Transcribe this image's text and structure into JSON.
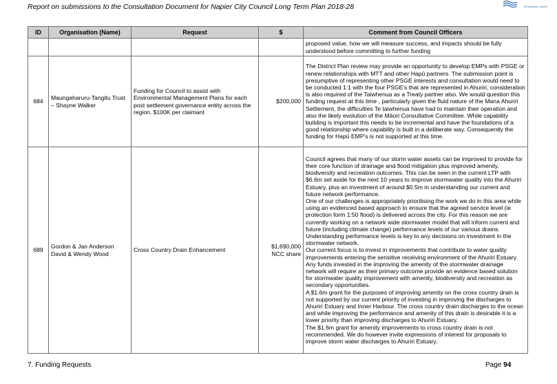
{
  "header": {
    "title": "Report on submissions to the Consultation Document for Napier City Council Long Term Plan 2018-28",
    "logo_caption": "Te Kaunihera o Ahuriri"
  },
  "table": {
    "columns": [
      "ID",
      "Organisation (Name)",
      "Request",
      "$",
      "Comment from Council Officers"
    ],
    "continuation": {
      "comment": "proposed value, how we will measure success, and impacts should be fully understood before committing to further funding"
    },
    "rows": [
      {
        "id": "684",
        "organisation": "Maungaharuru-Tangitu Trust – Shayne Walker",
        "request": "Funding for Council to assist with Environmental Management Plans for each post settlement governance entity across the region. $100K per claimant",
        "amount": "$200,000",
        "comment": [
          "The District Plan review may provide an opportunity to develop EMPs with PSGE or renew relationships with MTT and other Hapū partners.  The submission point is presumptive of representing other PSGE interests and consultation would need to be conducted 1:1 with the four PSGE's that are represented in Ahuriri, consideration is also required of the Taiwhenua as a Treaty partner also. We would question this funding request at this time , particularly given the fluid nature of the Mana Ahuriri Settlement, the difficulties Te taiwhenua have had to maintain their operation and also the likely evolution of the Māori Consultative Committee.  While capability building is important this needs to be incremental and have the foundations of a good relationship where capability is built in a deliberate way.  Consequently the funding for Hapū EMP's is not supported at this time."
        ]
      },
      {
        "id": "689",
        "organisation": "Gordon & Jan Anderson David & Wendy Wood",
        "request": "Cross Country Drain Enhancement",
        "amount": "$1,690,000 NCC share",
        "comment": [
          "Council agrees that many of our storm water assets can be improved to provide for their core function of drainage and flood mitigation plus improved amenity, biodiversity and recreation outcomes. This can be seen in the current LTP with  $6.6m set aside for the next 10 years to improve stormwater quality into the Ahuriri Estuary, plus an investment of around $0.5m in understanding our current and future network performance.",
          "One of our challenges is appropriately prioritising the work we do in this area while using an evidenced based approach to ensure that the agreed service level (ie protection form 1:50 flood) is delivered across the city. For this reason we are currently working on a network wide stormwater model that will inform current and future (including climate change) performance levels of our various drains. Understanding performance levels is key to any decisions on investment in the stormwater network.",
          "Our current focus is to invest in improvements that contribute to water quality improvements entering the sensitive receiving environment of the Ahuriri Estuary. Any funds invested in the improving the amenity of the stormwater drainage network will require as their primary outcome provide an evidence based solution for stormwater quality improvement with amenity, biodiversity and recreation as secondary opportunities.",
          "A $1.6m grant for the purposes of improving amenity on the cross country drain is not supported by our current priority of investing in improving the discharges to Ahuriri Estuary and Inner Harbour. The cross country drain discharges to the ocean and while improving the performance and amenity of this drain is desirable it is a lower priority than improving discharges to Ahuriri Estuary.",
          "The $1.6m grant for amenity improvements to cross country drain is not recommended. We do however invite expressions of interest for proposals to improve storm water discharges to Ahuriri Estuary."
        ]
      }
    ]
  },
  "footer": {
    "section": "7. Funding Requests",
    "page_label": "Page",
    "page_number": "94"
  }
}
